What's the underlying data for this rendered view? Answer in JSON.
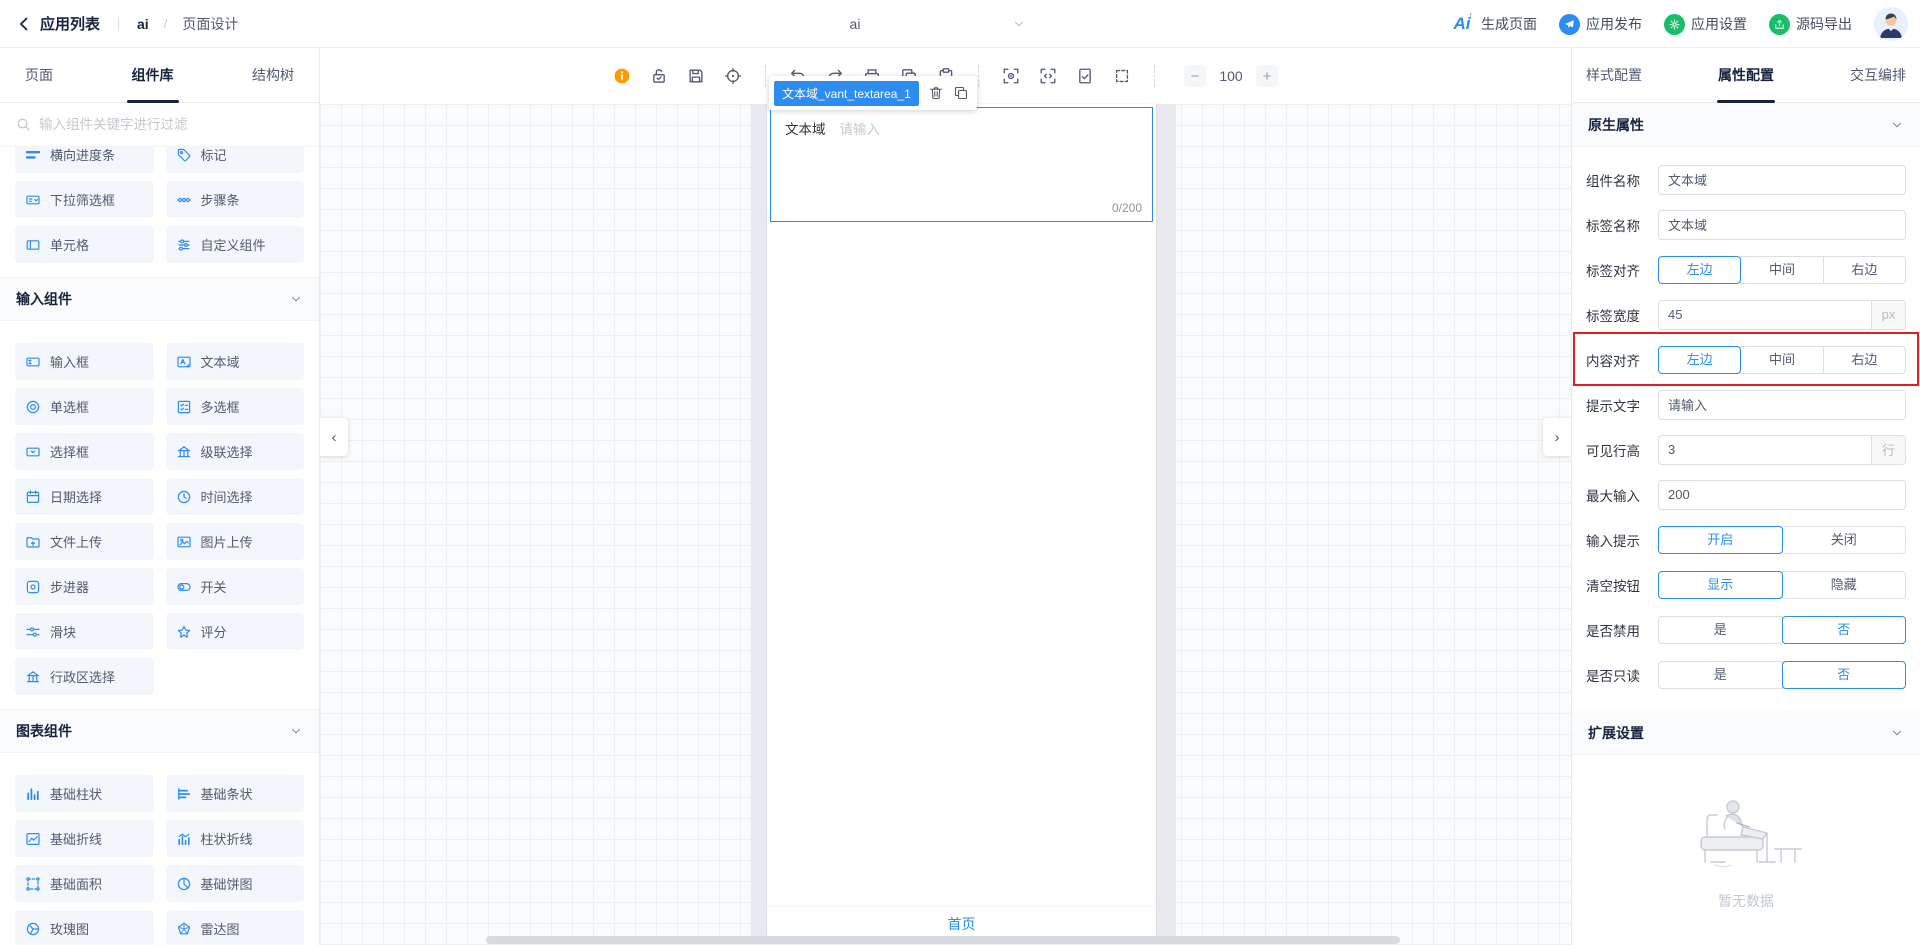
{
  "colors": {
    "accent": "#2d8cf0",
    "highlight_border": "#e02020",
    "info_orange": "#ff9900",
    "green": "#19be6b"
  },
  "header": {
    "back_label": "应用列表",
    "breadcrumb_app": "ai",
    "breadcrumb_sep": "/",
    "breadcrumb_page": "页面设计",
    "page_select_value": "ai",
    "actions": [
      {
        "id": "generate-page",
        "icon": "ai-logo",
        "label": "生成页面",
        "bg": ""
      },
      {
        "id": "publish-app",
        "icon": "paper-plane",
        "label": "应用发布",
        "bg": "#2d8cf0"
      },
      {
        "id": "app-settings",
        "icon": "gear",
        "label": "应用设置",
        "bg": "#19be6b"
      },
      {
        "id": "export-source",
        "icon": "export",
        "label": "源码导出",
        "bg": "#19be6b"
      }
    ]
  },
  "sidebar": {
    "tabs": [
      {
        "id": "pages",
        "label": "页面",
        "active": false
      },
      {
        "id": "components",
        "label": "组件库",
        "active": true
      },
      {
        "id": "structure-tree",
        "label": "结构树",
        "active": false
      }
    ],
    "search_placeholder": "输入组件关键字进行过滤",
    "groups": [
      {
        "header": "",
        "items": [
          {
            "label": "横向进度条",
            "icon": "progress"
          },
          {
            "label": "标记",
            "icon": "tag"
          },
          {
            "label": "下拉筛选框",
            "icon": "dropdown-filter"
          },
          {
            "label": "步骤条",
            "icon": "steps"
          },
          {
            "label": "单元格",
            "icon": "cell"
          },
          {
            "label": "自定义组件",
            "icon": "custom"
          }
        ]
      },
      {
        "header": "输入组件",
        "items": [
          {
            "label": "输入框",
            "icon": "input"
          },
          {
            "label": "文本域",
            "icon": "textarea"
          },
          {
            "label": "单选框",
            "icon": "radio"
          },
          {
            "label": "多选框",
            "icon": "checklist"
          },
          {
            "label": "选择框",
            "icon": "select"
          },
          {
            "label": "级联选择",
            "icon": "columns"
          },
          {
            "label": "日期选择",
            "icon": "calendar"
          },
          {
            "label": "时间选择",
            "icon": "clock"
          },
          {
            "label": "文件上传",
            "icon": "folder-up"
          },
          {
            "label": "图片上传",
            "icon": "image-up"
          },
          {
            "label": "步进器",
            "icon": "stepper"
          },
          {
            "label": "开关",
            "icon": "switch"
          },
          {
            "label": "滑块",
            "icon": "slider"
          },
          {
            "label": "评分",
            "icon": "star"
          },
          {
            "label": "行政区选择",
            "icon": "columns"
          }
        ]
      },
      {
        "header": "图表组件",
        "items": [
          {
            "label": "基础柱状",
            "icon": "bar-chart"
          },
          {
            "label": "基础条状",
            "icon": "barh-chart"
          },
          {
            "label": "基础折线",
            "icon": "line-chart"
          },
          {
            "label": "柱状折线",
            "icon": "combo-chart"
          },
          {
            "label": "基础面积",
            "icon": "area-chart"
          },
          {
            "label": "基础饼图",
            "icon": "pie-chart"
          },
          {
            "label": "玫瑰图",
            "icon": "rose-chart"
          },
          {
            "label": "雷达图",
            "icon": "radar-chart"
          }
        ]
      }
    ]
  },
  "toolbar": {
    "icons": [
      "info",
      "unlock-check",
      "save",
      "target",
      "|",
      "undo",
      "redo",
      "printer",
      "copy",
      "clipboard",
      "|",
      "scan-eye",
      "scan-code",
      "doc-check",
      "frame-dashed",
      "|"
    ],
    "zoom_minus": "−",
    "zoom_value": "100",
    "zoom_plus": "+"
  },
  "canvas": {
    "selected_component_tag": "文本域_vant_textarea_1",
    "component": {
      "label": "文本域",
      "placeholder": "请输入",
      "counter": "0/200"
    },
    "bottom_tab_label": "首页",
    "collapse_left": "‹",
    "collapse_right": "›"
  },
  "properties_panel": {
    "tabs": [
      {
        "id": "style-config",
        "label": "样式配置",
        "active": false
      },
      {
        "id": "props-config",
        "label": "属性配置",
        "active": true
      },
      {
        "id": "interaction-config",
        "label": "交互编排",
        "active": false
      }
    ],
    "native_section_title": "原生属性",
    "rows": [
      {
        "label": "组件名称",
        "type": "input",
        "value": "文本域"
      },
      {
        "label": "标签名称",
        "type": "input",
        "value": "文本域"
      },
      {
        "label": "标签对齐",
        "type": "seg",
        "options": [
          "左边",
          "中间",
          "右边"
        ],
        "selected": 0
      },
      {
        "label": "标签宽度",
        "type": "input-suffix",
        "value": "45",
        "suffix": "px"
      },
      {
        "label": "内容对齐",
        "type": "seg",
        "options": [
          "左边",
          "中间",
          "右边"
        ],
        "selected": 0,
        "highlighted": true
      },
      {
        "label": "提示文字",
        "type": "input",
        "value": "请输入"
      },
      {
        "label": "可见行高",
        "type": "input-suffix",
        "value": "3",
        "suffix": "行"
      },
      {
        "label": "最大输入",
        "type": "input",
        "value": "200"
      },
      {
        "label": "输入提示",
        "type": "seg",
        "options": [
          "开启",
          "关闭"
        ],
        "selected": 0
      },
      {
        "label": "清空按钮",
        "type": "seg",
        "options": [
          "显示",
          "隐藏"
        ],
        "selected": 0
      },
      {
        "label": "是否禁用",
        "type": "seg",
        "options": [
          "是",
          "否"
        ],
        "selected": 1
      },
      {
        "label": "是否只读",
        "type": "seg",
        "options": [
          "是",
          "否"
        ],
        "selected": 1
      }
    ],
    "extend_section_title": "扩展设置",
    "empty_text": "暂无数据"
  }
}
